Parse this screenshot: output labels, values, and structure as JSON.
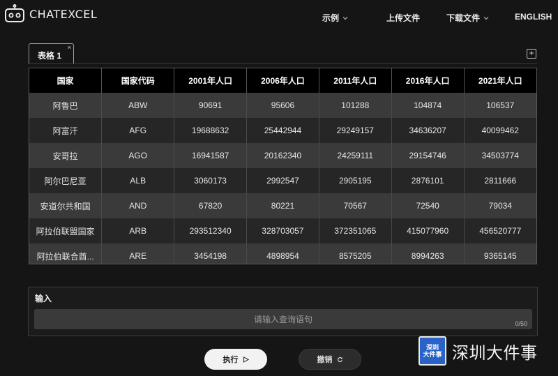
{
  "app": {
    "logo_text": "ChatExcel"
  },
  "nav": {
    "examples": "示例",
    "upload": "上传文件",
    "download": "下载文件",
    "language": "ENGLISH"
  },
  "tabs": [
    {
      "label": "表格 1",
      "close_icon": "×"
    }
  ],
  "add_tab_icon": "+",
  "table": {
    "headers": [
      "国家",
      "国家代码",
      "2001年人口",
      "2006年人口",
      "2011年人口",
      "2016年人口",
      "2021年人口"
    ],
    "rows": [
      [
        "阿鲁巴",
        "ABW",
        "90691",
        "95606",
        "101288",
        "104874",
        "106537"
      ],
      [
        "阿富汗",
        "AFG",
        "19688632",
        "25442944",
        "29249157",
        "34636207",
        "40099462"
      ],
      [
        "安哥拉",
        "AGO",
        "16941587",
        "20162340",
        "24259111",
        "29154746",
        "34503774"
      ],
      [
        "阿尔巴尼亚",
        "ALB",
        "3060173",
        "2992547",
        "2905195",
        "2876101",
        "2811666"
      ],
      [
        "安道尔共和国",
        "AND",
        "67820",
        "80221",
        "70567",
        "72540",
        "79034"
      ],
      [
        "阿拉伯联盟国家",
        "ARB",
        "293512340",
        "328703057",
        "372351065",
        "415077960",
        "456520777"
      ],
      [
        "阿拉伯联合酋...",
        "ARE",
        "3454198",
        "4898954",
        "8575205",
        "8994263",
        "9365145"
      ]
    ]
  },
  "input_panel": {
    "title": "输入",
    "placeholder": "请输入查询语句",
    "value": "",
    "char_count": "0/50"
  },
  "buttons": {
    "execute": "执行",
    "revoke": "撤销"
  },
  "watermark": {
    "badge_line1": "深圳",
    "badge_line2": "大件事",
    "text": "深圳大件事"
  },
  "colors": {
    "background": "#151515",
    "header_row": "#000000",
    "row_odd": "#3a3a3a",
    "row_even": "#262626",
    "execute_button": "#f2f2f2",
    "watermark_badge": "#2a63c8"
  }
}
